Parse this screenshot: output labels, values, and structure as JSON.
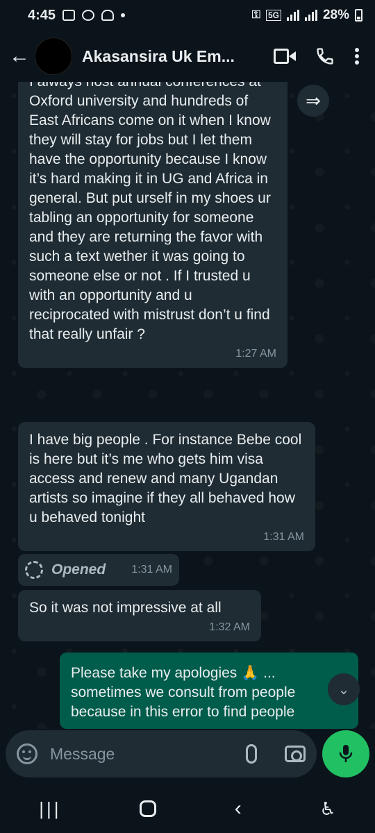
{
  "status": {
    "time": "4:45",
    "network": "5G",
    "battery": "28%"
  },
  "header": {
    "contact_name": "Akasansira Uk Em..."
  },
  "messages": [
    {
      "direction": "incoming",
      "text": "I always host annual conferences at Oxford university and hundreds of East Africans come on it when I know they will stay for jobs but I let them have the opportunity because I know it’s hard making it in UG and Africa in general. But put urself in my shoes ur tabling an opportunity for someone and they are returning the favor with such a text wether it was going to someone else or not . If I trusted u with an opportunity and u reciprocated with mistrust don’t u find that really unfair ?",
      "time": "1:27 AM"
    },
    {
      "direction": "incoming",
      "text": "I have big people . For instance Bebe cool is here but it’s me who gets him visa access and renew and many Ugandan artists so imagine if they all behaved how u behaved tonight",
      "time": "1:31 AM"
    },
    {
      "direction": "incoming",
      "type": "view-once",
      "text": "Opened",
      "time": "1:31 AM"
    },
    {
      "direction": "incoming",
      "text": "So it was not impressive at all",
      "time": "1:32 AM"
    },
    {
      "direction": "outgoing",
      "text": "Please take my apologies 🙏 ... sometimes we consult from people because in this error to find people"
    }
  ],
  "composer": {
    "placeholder": "Message"
  },
  "colors": {
    "background": "#0b141a",
    "incoming_bubble": "#1f2c33",
    "outgoing_bubble": "#005c4b",
    "accent_green": "#21c063"
  },
  "icons": [
    "back-arrow-icon",
    "video-call-icon",
    "phone-icon",
    "more-options-icon",
    "forward-icon",
    "emoji-icon",
    "attach-icon",
    "camera-icon",
    "mic-icon",
    "scroll-down-icon"
  ]
}
